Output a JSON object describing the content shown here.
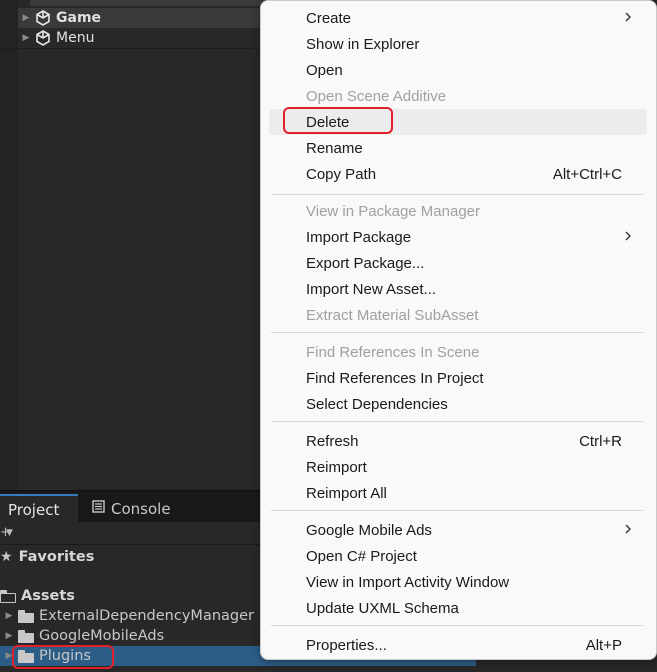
{
  "hierarchy": {
    "items": [
      {
        "label": "Game",
        "bold": true
      },
      {
        "label": "Menu",
        "bold": false
      }
    ]
  },
  "project": {
    "tabs": [
      {
        "label": "Project",
        "icon": "folder-icon",
        "active": true
      },
      {
        "label": "Console",
        "icon": "console-icon",
        "active": false
      }
    ],
    "favorites_label": "Favorites",
    "assets_label": "Assets",
    "folders": [
      {
        "label": "ExternalDependencyManager"
      },
      {
        "label": "GoogleMobileAds"
      },
      {
        "label": "Plugins"
      }
    ]
  },
  "context_menu": {
    "items": [
      {
        "label": "Create",
        "submenu": true
      },
      {
        "label": "Show in Explorer"
      },
      {
        "label": "Open"
      },
      {
        "label": "Open Scene Additive",
        "disabled": true
      },
      {
        "label": "Delete",
        "hovered": true,
        "highlighted": true
      },
      {
        "label": "Rename"
      },
      {
        "label": "Copy Path",
        "shortcut": "Alt+Ctrl+C"
      },
      {
        "label": "View in Package Manager",
        "disabled": true
      },
      {
        "label": "Import Package",
        "submenu": true
      },
      {
        "label": "Export Package..."
      },
      {
        "label": "Import New Asset..."
      },
      {
        "label": "Extract Material SubAsset",
        "disabled": true
      },
      {
        "label": "Find References In Scene",
        "disabled": true
      },
      {
        "label": "Find References In Project"
      },
      {
        "label": "Select Dependencies"
      },
      {
        "label": "Refresh",
        "shortcut": "Ctrl+R"
      },
      {
        "label": "Reimport"
      },
      {
        "label": "Reimport All"
      },
      {
        "label": "Google Mobile Ads",
        "submenu": true
      },
      {
        "label": "Open C# Project"
      },
      {
        "label": "View in Import Activity Window"
      },
      {
        "label": "Update UXML Schema"
      },
      {
        "label": "Properties...",
        "shortcut": "Alt+P"
      }
    ]
  },
  "colors": {
    "highlight": "#e0202a",
    "selection": "#2c5d87",
    "tab_accent": "#3a79bb"
  }
}
